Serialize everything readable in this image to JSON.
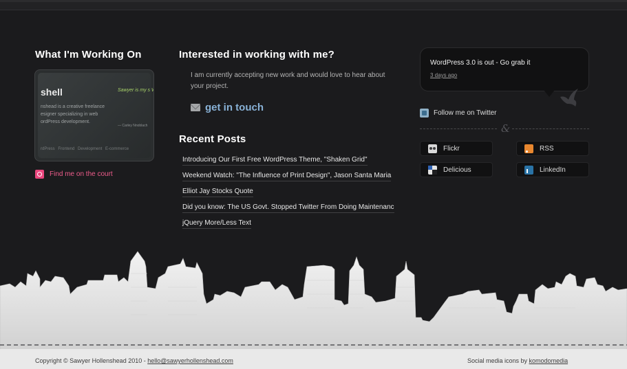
{
  "working_on": {
    "heading": "What I'm Working On",
    "card": {
      "title": "shell",
      "description": "nshead is a creative freelance esigner specializing in web ordPress development.",
      "quote": "Sawyer is my s Wordpress bla record time! H everything unt",
      "cite": "— Carley Nnoblach",
      "tags": "rdPress Frontend Development E-commerce"
    },
    "court_link": "Find me on the court"
  },
  "interested": {
    "heading": "Interested in working with me?",
    "body": "I am currently accepting new work and would love to hear about your project.",
    "cta": "get in touch"
  },
  "recent_posts": {
    "heading": "Recent Posts",
    "items": [
      "Introducing Our First Free WordPress Theme, \"Shaken Grid\"",
      "Weekend Watch: \"The Influence of Print Design\", Jason Santa Maria",
      "Elliot Jay Stocks Quote",
      "Did you know: The US Govt. Stopped Twitter From Doing Maintenanc",
      "jQuery More/Less Text"
    ]
  },
  "twitter": {
    "tweet": "WordPress 3.0 is out - Go grab it",
    "time": "3 days ago",
    "follow": "Follow me on Twitter",
    "separator": "&"
  },
  "social": {
    "flickr": "Flickr",
    "rss": "RSS",
    "delicious": "Delicious",
    "linkedin": "LinkedIn"
  },
  "footer": {
    "copyright": "Copyright © Sawyer Hollenshead 2010 - ",
    "email": "hello@sawyerhollenshead.com",
    "credit": "Social media icons by ",
    "credit_link": "komodomedia"
  },
  "colors": {
    "background": "#1b1b1d",
    "accent_pink": "#ee5c8b",
    "accent_blue": "#88b1d6",
    "card_quote_green": "#a9d46a"
  },
  "icons": {
    "court": "dribbble-icon",
    "contact": "envelope-icon",
    "twitter": "twitter-icon",
    "bird": "bird-icon",
    "flickr": "flickr-icon",
    "rss": "rss-icon",
    "delicious": "delicious-icon",
    "linkedin": "linkedin-icon"
  }
}
